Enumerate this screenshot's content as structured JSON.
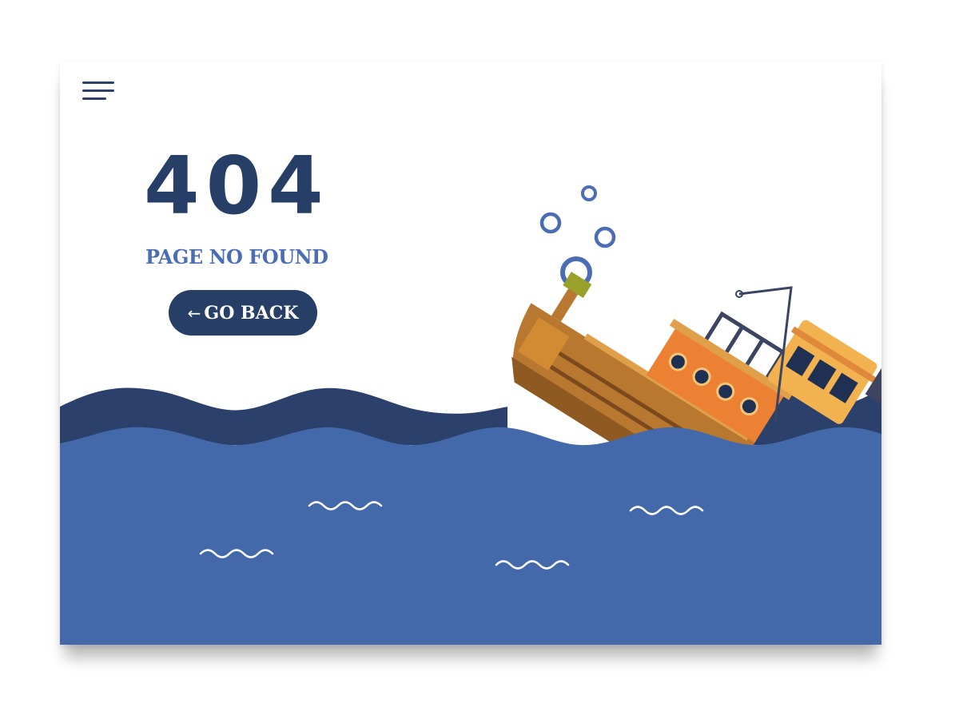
{
  "error": {
    "code": "404",
    "message": "PAGE NO FOUND"
  },
  "actions": {
    "go_back_icon": "←",
    "go_back_label": "GO BACK"
  },
  "icons": {
    "menu": "hamburger-menu-icon",
    "back": "arrow-left-icon"
  },
  "colors": {
    "navy": "#273f67",
    "accent_blue": "#4a6db3",
    "sea": "#4469ab",
    "wave_back": "#2b416b",
    "ship_orange": "#ed8133",
    "ship_yellow": "#f2b24f",
    "ship_brown": "#b87830"
  }
}
